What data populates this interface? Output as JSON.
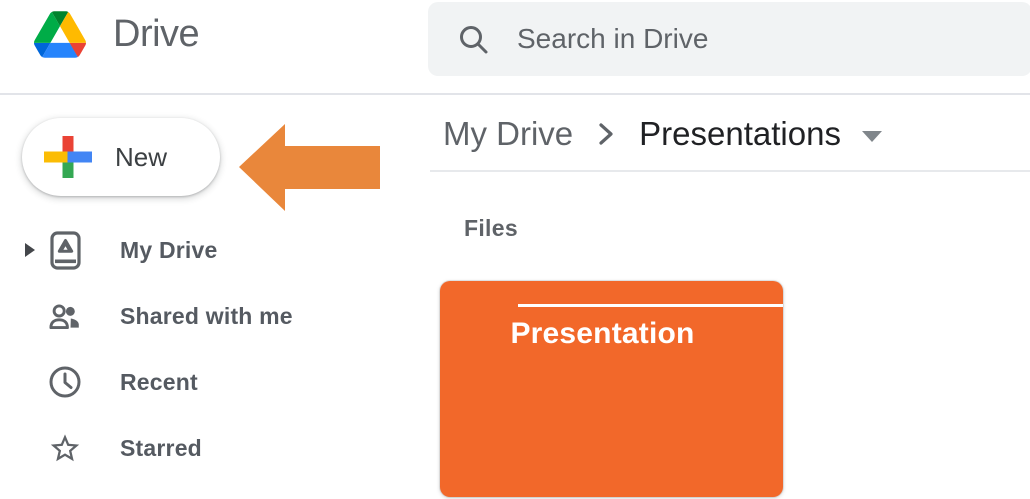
{
  "header": {
    "app_name": "Drive",
    "search_placeholder": "Search in Drive"
  },
  "sidebar": {
    "new_button_label": "New",
    "items": [
      {
        "label": "My Drive",
        "icon": "my-drive-icon",
        "expandable": true
      },
      {
        "label": "Shared with me",
        "icon": "people-icon",
        "expandable": false
      },
      {
        "label": "Recent",
        "icon": "clock-icon",
        "expandable": false
      },
      {
        "label": "Starred",
        "icon": "star-icon",
        "expandable": false
      }
    ]
  },
  "breadcrumb": {
    "root": "My Drive",
    "current": "Presentations"
  },
  "content": {
    "section_label": "Files",
    "file_card_title": "Presentation"
  },
  "icons": {
    "logo": "google-drive-triangle",
    "search": "magnifier",
    "new_button": "multicolor-plus",
    "breadcrumb_separator": "chevron-right",
    "breadcrumb_menu": "triangle-down-caret",
    "annotation": "orange-arrow-pointing-left-at-new-button"
  },
  "colors": {
    "card_orange": "#F2682A",
    "arrow_orange": "#E9873B",
    "icon_gray": "#5F6368"
  }
}
